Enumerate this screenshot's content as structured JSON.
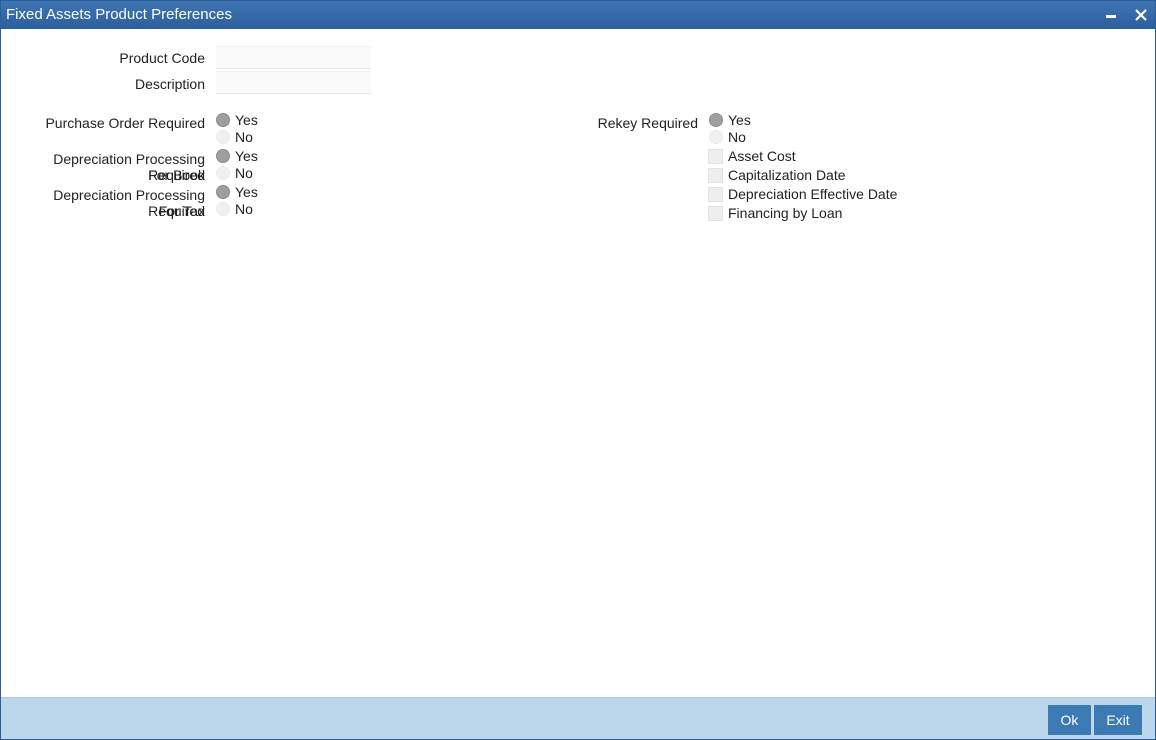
{
  "window": {
    "title": "Fixed Assets Product Preferences"
  },
  "fields": {
    "product_code_label": "Product Code",
    "product_code_value": "",
    "description_label": "Description",
    "description_value": ""
  },
  "purchase_order": {
    "label": "Purchase Order Required",
    "yes": "Yes",
    "no": "No",
    "selected": "Yes"
  },
  "depreciation_book": {
    "label_line1": "Depreciation Processing Required",
    "label_line2": "For Book",
    "yes": "Yes",
    "no": "No",
    "selected": "Yes"
  },
  "depreciation_tax": {
    "label_line1": "Depreciation Processing Required",
    "label_line2": "For Tax",
    "yes": "Yes",
    "no": "No",
    "selected": "Yes"
  },
  "rekey": {
    "label": "Rekey Required",
    "yes": "Yes",
    "no": "No",
    "selected": "Yes",
    "options": [
      {
        "label": "Asset Cost",
        "checked": false
      },
      {
        "label": "Capitalization Date",
        "checked": false
      },
      {
        "label": "Depreciation Effective Date",
        "checked": false
      },
      {
        "label": "Financing by Loan",
        "checked": false
      }
    ]
  },
  "footer": {
    "ok_label": "Ok",
    "exit_label": "Exit"
  },
  "colors": {
    "titlebar": "#2c5f9c",
    "footer": "#bcd6ec",
    "button": "#3c7ab4"
  }
}
